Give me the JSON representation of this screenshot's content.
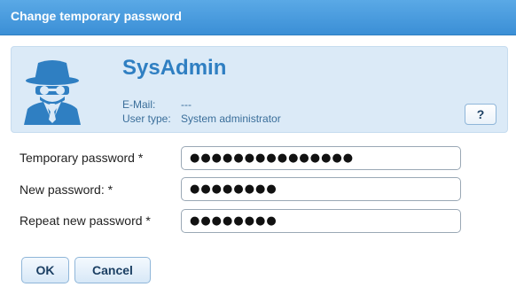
{
  "dialog": {
    "title": "Change temporary password"
  },
  "user": {
    "name": "SysAdmin",
    "email_label": "E-Mail:",
    "email_value": "---",
    "type_label": "User type:",
    "type_value": "System administrator",
    "avatar_icon": "spy-agent-icon",
    "help_label": "?"
  },
  "form": {
    "temp_label": "Temporary password *",
    "temp_value": "●●●●●●●●●●●●●●●",
    "new_label": "New password: *",
    "new_value": "●●●●●●●●",
    "repeat_label": "Repeat new password *",
    "repeat_value": "●●●●●●●●"
  },
  "buttons": {
    "ok_label": "OK",
    "cancel_label": "Cancel"
  },
  "colors": {
    "titlebar": "#3b8fd6",
    "panel": "#dbeaf7",
    "accent": "#2f7fc2"
  }
}
